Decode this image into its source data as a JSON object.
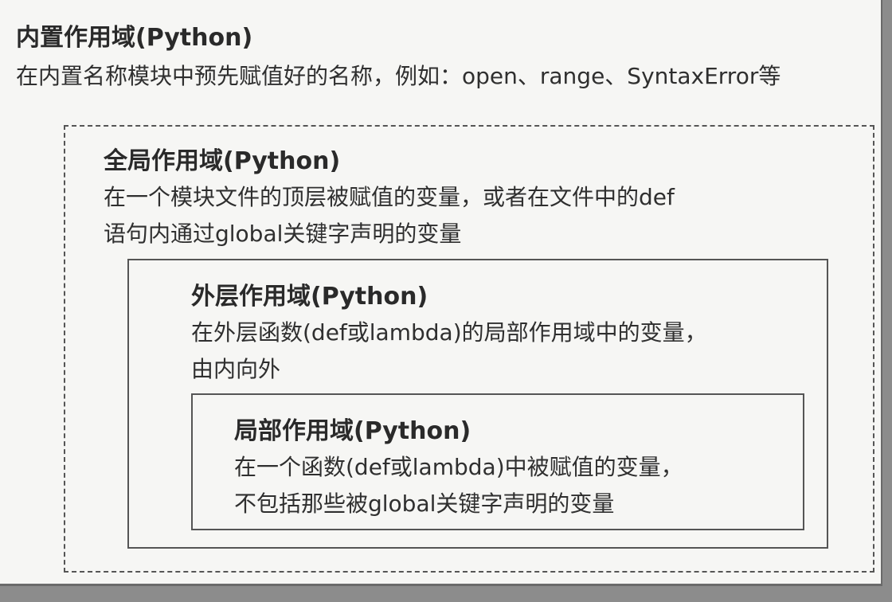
{
  "scopes": {
    "builtin": {
      "title": "内置作用域(Python)",
      "lines": [
        "在内置名称模块中预先赋值好的名称，例如：open、range、SyntaxError等"
      ]
    },
    "global": {
      "title": "全局作用域(Python)",
      "lines": [
        "在一个模块文件的顶层被赋值的变量，或者在文件中的def",
        "语句内通过global关键字声明的变量"
      ]
    },
    "enclosing": {
      "title": "外层作用域(Python)",
      "lines": [
        "在外层函数(def或lambda)的局部作用域中的变量，",
        "由内向外"
      ]
    },
    "local": {
      "title": "局部作用域(Python)",
      "lines": [
        "在一个函数(def或lambda)中被赋值的变量，",
        "不包括那些被global关键字声明的变量"
      ]
    }
  }
}
